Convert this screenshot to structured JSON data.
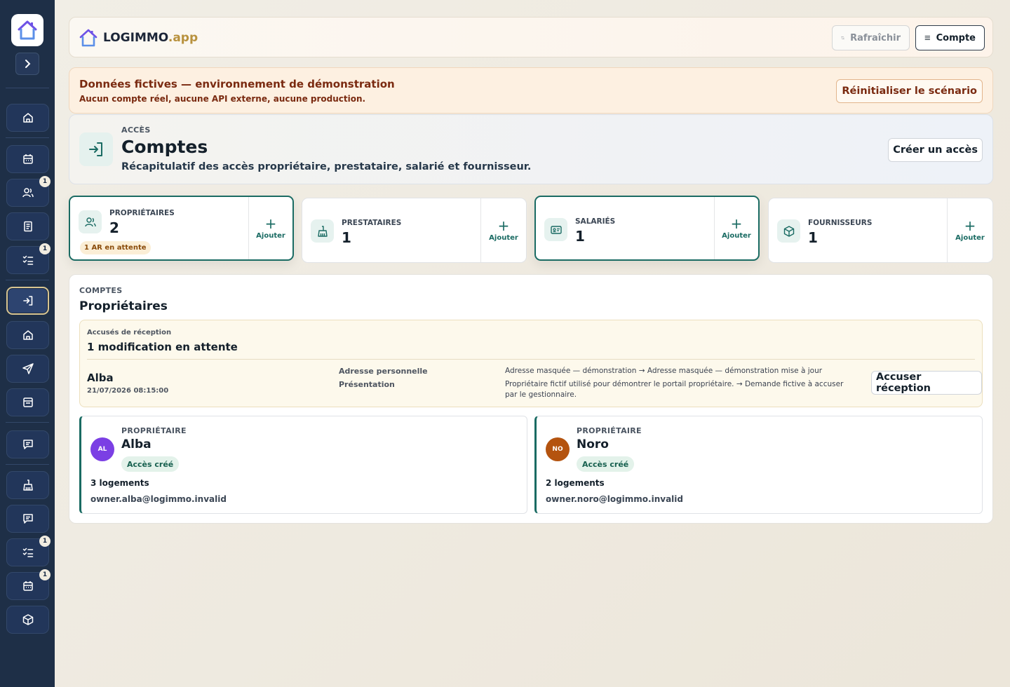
{
  "app": {
    "brand_main": "LOGIMMO",
    "brand_tld": ".app"
  },
  "topbar": {
    "refresh_label": "Rafraîchir",
    "account_label": "Compte"
  },
  "banner": {
    "title": "Données fictives — environnement de démonstration",
    "subtitle": "Aucun compte réel, aucune API externe, aucune production.",
    "reset_label": "Réinitialiser le scénario"
  },
  "header": {
    "eyebrow": "ACCÈS",
    "title": "Comptes",
    "subtitle": "Récapitulatif des accès propriétaire, prestataire, salarié et fournisseur.",
    "create_label": "Créer un accès"
  },
  "sidebar": {
    "items": [
      {
        "icon": "home-icon",
        "badge": ""
      },
      {
        "icon": "calendar-icon",
        "badge": ""
      },
      {
        "icon": "users-icon",
        "badge": "1"
      },
      {
        "icon": "document-icon",
        "badge": ""
      },
      {
        "icon": "checklist-icon",
        "badge": "1"
      },
      {
        "icon": "login-icon",
        "badge": "",
        "active": true
      },
      {
        "icon": "home-icon",
        "badge": ""
      },
      {
        "icon": "send-icon",
        "badge": ""
      },
      {
        "icon": "inbox-icon",
        "badge": ""
      },
      {
        "icon": "message-icon",
        "badge": ""
      },
      {
        "icon": "broom-icon",
        "badge": ""
      },
      {
        "icon": "message-icon",
        "badge": ""
      },
      {
        "icon": "checklist-icon",
        "badge": "1"
      },
      {
        "icon": "calendar-icon",
        "badge": "1"
      },
      {
        "icon": "box-icon",
        "badge": ""
      }
    ]
  },
  "stats": [
    {
      "label": "PROPRIÉTAIRES",
      "value": "2",
      "add_label": "Ajouter",
      "pending": "1 AR en attente",
      "icon": "users-icon"
    },
    {
      "label": "PRESTATAIRES",
      "value": "1",
      "add_label": "Ajouter",
      "icon": "broom-icon"
    },
    {
      "label": "SALARIÉS",
      "value": "1",
      "add_label": "Ajouter",
      "icon": "id-card-icon"
    },
    {
      "label": "FOURNISSEURS",
      "value": "1",
      "add_label": "Ajouter",
      "icon": "box-icon"
    }
  ],
  "comptes": {
    "eyebrow": "COMPTES",
    "title": "Propriétaires",
    "ack": {
      "eyebrow": "Accusés de réception",
      "title": "1 modification en attente",
      "name": "Alba",
      "date": "21/07/2026 08:15:00",
      "field_1": "Adresse personnelle",
      "field_2": "Présentation",
      "change_1": "Adresse masquée — démonstration → Adresse masquée — démonstration mise à jour",
      "change_2": "Propriétaire fictif utilisé pour démontrer le portail propriétaire. → Demande fictive à accuser par le gestionnaire.",
      "button_label": "Accuser réception"
    },
    "owners": [
      {
        "eyebrow": "PROPRIÉTAIRE",
        "initials": "AL",
        "name": "Alba",
        "status": "Accès créé",
        "units": "3 logements",
        "email": "owner.alba@logimmo.invalid",
        "color": "#7b3fe4"
      },
      {
        "eyebrow": "PROPRIÉTAIRE",
        "initials": "NO",
        "name": "Noro",
        "status": "Accès créé",
        "units": "2 logements",
        "email": "owner.noro@logimmo.invalid",
        "color": "#b4530f"
      }
    ]
  },
  "colors": {
    "sidebar": "#1e2f47",
    "accent": "#1a6b63",
    "banner_text": "#7a2a10"
  }
}
